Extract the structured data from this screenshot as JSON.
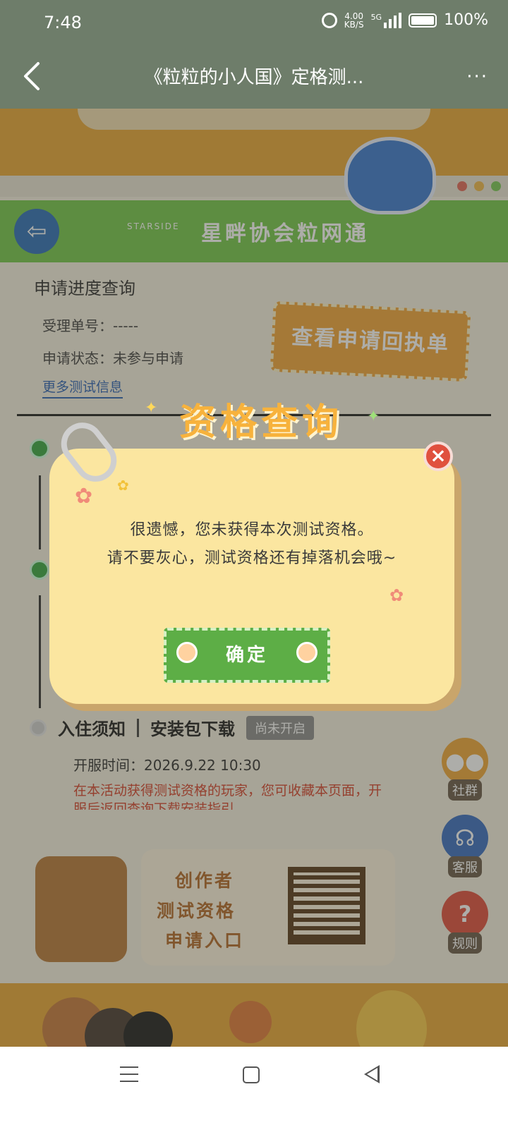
{
  "status_bar": {
    "time": "7:48",
    "net_speed": "4.00",
    "net_unit": "KB/S",
    "network": "5G",
    "battery": "100%"
  },
  "header": {
    "title": "《粒粒的小人国》定格测...",
    "more": "···"
  },
  "banner": {
    "logo_text": "STARSIDE",
    "brand": "星畔协会粒网通"
  },
  "progress": {
    "title": "申请进度查询",
    "ticket": "受理单号：-----",
    "status": "申请状态：未参与申请",
    "more_info": "更多测试信息",
    "receipt_button": "查看申请回执单"
  },
  "steps": {
    "step3_title": "入住须知",
    "step3_sub": "安装包下载",
    "step3_badge": "尚未开启",
    "open_time": "开服时间：2026.9.22   10:30",
    "note": "在本活动获得测试资格的玩家，您可收藏本页面，开服后返回查询下载安装指引"
  },
  "side": {
    "community": "社群",
    "service": "客服",
    "rules": "规则"
  },
  "creator": {
    "line1": "创作者",
    "line2": "测试资格",
    "line3": "申请入口"
  },
  "modal": {
    "title": "资格查询",
    "line1": "很遗憾，您未获得本次测试资格。",
    "line2": "请不要灰心，测试资格还有掉落机会哦~",
    "ok_button": "确定",
    "close": "×"
  },
  "colors": {
    "accent_orange": "#e8a838",
    "accent_green": "#76c84c",
    "modal_bg": "#fbe6a0",
    "close_red": "#e0503e"
  }
}
